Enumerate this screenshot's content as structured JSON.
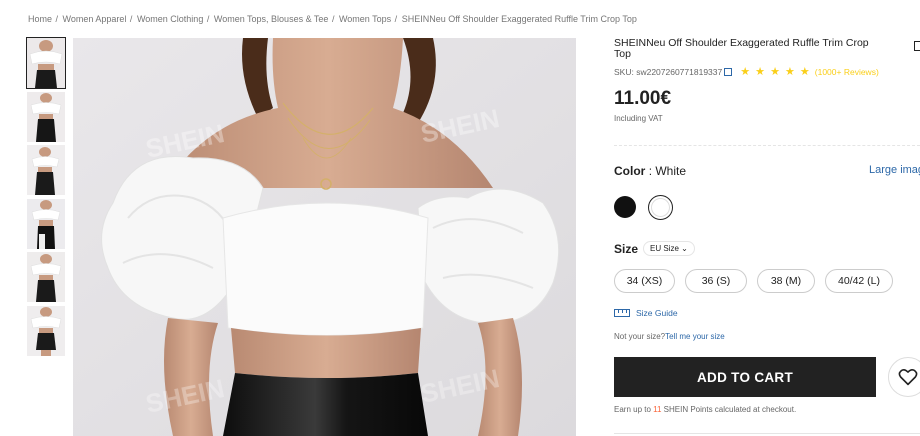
{
  "breadcrumb": [
    "Home",
    "Women Apparel",
    "Women Clothing",
    "Women Tops, Blouses & Tee",
    "Women Tops",
    "SHEINNeu Off Shoulder Exaggerated Ruffle Trim Crop Top"
  ],
  "watermark": "SHEIN",
  "product": {
    "title": "SHEINNeu Off Shoulder Exaggerated Ruffle Trim Crop Top",
    "sku": "SKU: sw2207260771819337",
    "rating_stars": "★ ★ ★ ★ ★",
    "reviews": "(1000+ Reviews)",
    "price": "11.00€",
    "vat_note": "Including VAT"
  },
  "color": {
    "label": "Color",
    "value": ": White",
    "large_image_link": "Large imag",
    "swatches": [
      "black",
      "white"
    ]
  },
  "size": {
    "label": "Size",
    "selector": "EU Size ⌄",
    "options": [
      "34 (XS)",
      "36 (S)",
      "38 (M)",
      "40/42 (L)"
    ],
    "guide": "Size Guide",
    "not_your_size": "Not your size?",
    "tell_me": "Tell me your size"
  },
  "cart": {
    "add_to_cart": "ADD TO CART",
    "points_prefix": "Earn up to ",
    "points_num": "11",
    "points_suffix": " SHEIN Points calculated at checkout."
  },
  "colors": {
    "accent_link": "#2d68a8",
    "star": "#facf19",
    "cart_bg": "#222222",
    "points": "#fa6338"
  }
}
